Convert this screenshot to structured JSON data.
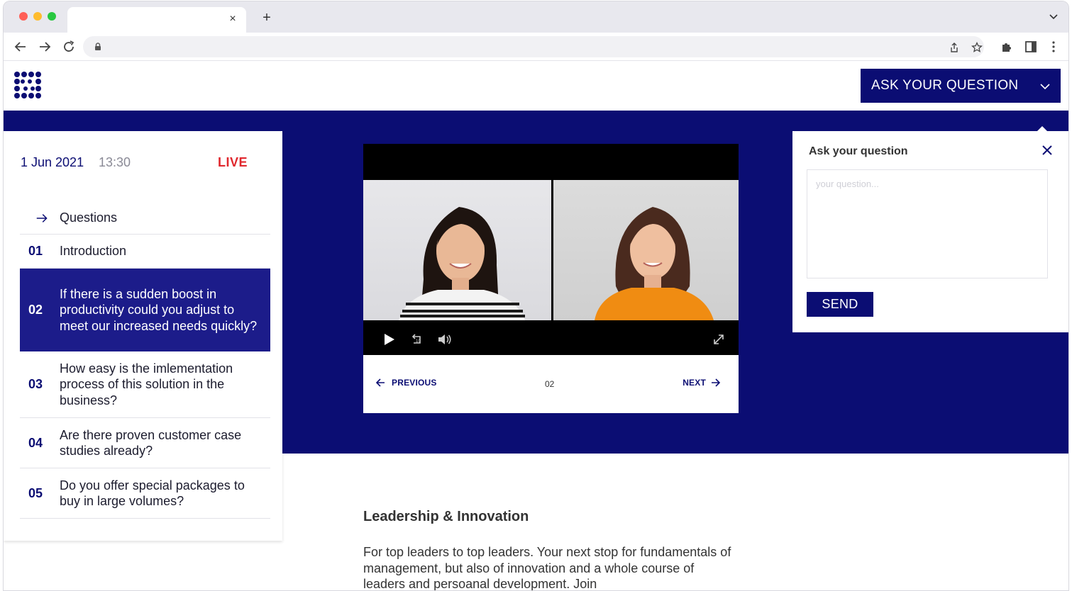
{
  "browser": {
    "tab_close": "×",
    "new_tab": "+"
  },
  "header": {
    "ask_button_label": "ASK YOUR QUESTION"
  },
  "session": {
    "date": "1 Jun 2021",
    "time": "13:30",
    "status": "LIVE"
  },
  "questions": {
    "heading": "Questions",
    "items": [
      {
        "num": "01",
        "text": "Introduction"
      },
      {
        "num": "02",
        "text": "If there is a sudden boost in productivity could you adjust to meet our increased needs quickly?"
      },
      {
        "num": "03",
        "text": "How easy is the imlementation process of this solution in the business?"
      },
      {
        "num": "04",
        "text": "Are there proven customer case studies already?"
      },
      {
        "num": "05",
        "text": "Do you offer special packages to buy in large volumes?"
      }
    ]
  },
  "pager": {
    "previous": "PREVIOUS",
    "current": "02",
    "next": "NEXT"
  },
  "question_panel": {
    "title": "Ask your question",
    "placeholder": "your question...",
    "send_label": "SEND"
  },
  "content": {
    "title": "Leadership & Innovation",
    "text": "For top leaders to top leaders. Your next stop for fundamentals of management, but also of innovation and a whole course of leaders and persoanal development. Join"
  },
  "colors": {
    "brand": "#0b0d73",
    "active_row": "#1c1c8a",
    "live": "#e0282e"
  }
}
